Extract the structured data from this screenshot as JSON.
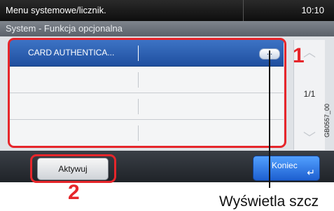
{
  "header": {
    "title": "Menu systemowe/licznik.",
    "time": "10:10",
    "subtitle": "System - Funkcja opcjonalna"
  },
  "list": {
    "rows": [
      {
        "label": "CARD AUTHENTICA...",
        "selected": true,
        "detail_icon": "ellipsis-icon",
        "detail_label": "..."
      },
      {
        "label": ""
      },
      {
        "label": ""
      },
      {
        "label": ""
      }
    ]
  },
  "scroll": {
    "page": "1/1",
    "up_icon": "chevron-up-icon",
    "down_icon": "chevron-down-icon"
  },
  "footer": {
    "activate_label": "Aktywuj",
    "end_label": "Koniec",
    "enter_icon": "enter-icon"
  },
  "annotations": {
    "marker_1": "1",
    "marker_2": "2",
    "callout": "Wyświetla szcz",
    "figure_code": "GB0557_00"
  },
  "colors": {
    "selected_row": "#2a5fb3",
    "highlight": "#e6262b",
    "end_button": "#2f7bea"
  }
}
